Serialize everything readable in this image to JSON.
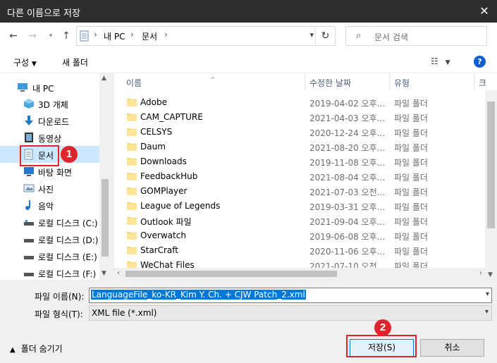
{
  "window": {
    "title": "다른 이름으로 저장"
  },
  "address": {
    "root": "내 PC",
    "current": "문서"
  },
  "search": {
    "placeholder": "문서 검색"
  },
  "toolbar": {
    "organize": "구성",
    "new_folder": "새 폴더"
  },
  "nav": {
    "items": [
      {
        "label": "내 PC",
        "icon": "pc-icon"
      },
      {
        "label": "3D 개체",
        "icon": "3d-objects-icon"
      },
      {
        "label": "다운로드",
        "icon": "download-icon"
      },
      {
        "label": "동영상",
        "icon": "video-icon"
      },
      {
        "label": "문서",
        "icon": "document-icon"
      },
      {
        "label": "바탕 화면",
        "icon": "desktop-icon"
      },
      {
        "label": "사진",
        "icon": "pictures-icon"
      },
      {
        "label": "음악",
        "icon": "music-icon"
      },
      {
        "label": "로컬 디스크 (C:)",
        "icon": "drive-icon"
      },
      {
        "label": "로컬 디스크 (D:)",
        "icon": "drive-icon"
      },
      {
        "label": "로컬 디스크 (E:)",
        "icon": "drive-icon"
      },
      {
        "label": "로컬 디스크 (F:)",
        "icon": "drive-icon"
      }
    ]
  },
  "columns": {
    "name": "이름",
    "date": "수정한 날짜",
    "type": "유형",
    "size": "크"
  },
  "files": [
    {
      "name": "Adobe",
      "date": "2019-04-02 오후...",
      "type": "파일 폴더"
    },
    {
      "name": "CAM_CAPTURE",
      "date": "2021-04-03 오후...",
      "type": "파일 폴더"
    },
    {
      "name": "CELSYS",
      "date": "2020-12-24 오후...",
      "type": "파일 폴더"
    },
    {
      "name": "Daum",
      "date": "2021-08-20 오후...",
      "type": "파일 폴더"
    },
    {
      "name": "Downloads",
      "date": "2019-11-08 오후...",
      "type": "파일 폴더"
    },
    {
      "name": "FeedbackHub",
      "date": "2021-08-04 오후...",
      "type": "파일 폴더"
    },
    {
      "name": "GOMPlayer",
      "date": "2021-07-03 오전...",
      "type": "파일 폴더"
    },
    {
      "name": "League of Legends",
      "date": "2019-03-31 오후...",
      "type": "파일 폴더"
    },
    {
      "name": "Outlook 파일",
      "date": "2021-09-04 오후...",
      "type": "파일 폴더"
    },
    {
      "name": "Overwatch",
      "date": "2019-06-08 오후...",
      "type": "파일 폴더"
    },
    {
      "name": "StarCraft",
      "date": "2020-11-06 오후...",
      "type": "파일 폴더"
    },
    {
      "name": "WeChat Files",
      "date": "2021-07-10 오전...",
      "type": "파일 폴더"
    }
  ],
  "form": {
    "filename_label": "파일 이름(N):",
    "filename_value": "LanguageFile_ko-KR_Kim Y. Ch. + CJW Patch_2.xml",
    "filetype_label": "파일 형식(T):",
    "filetype_value": "XML file (*.xml)"
  },
  "footer": {
    "hide_folders": "폴더 숨기기",
    "save": "저장(S)",
    "cancel": "취소"
  },
  "annotations": {
    "badge1": "1",
    "badge2": "2"
  },
  "colors": {
    "accent": "#0078d7",
    "highlight": "#e0242d",
    "selected_bg": "#cce8ff"
  }
}
